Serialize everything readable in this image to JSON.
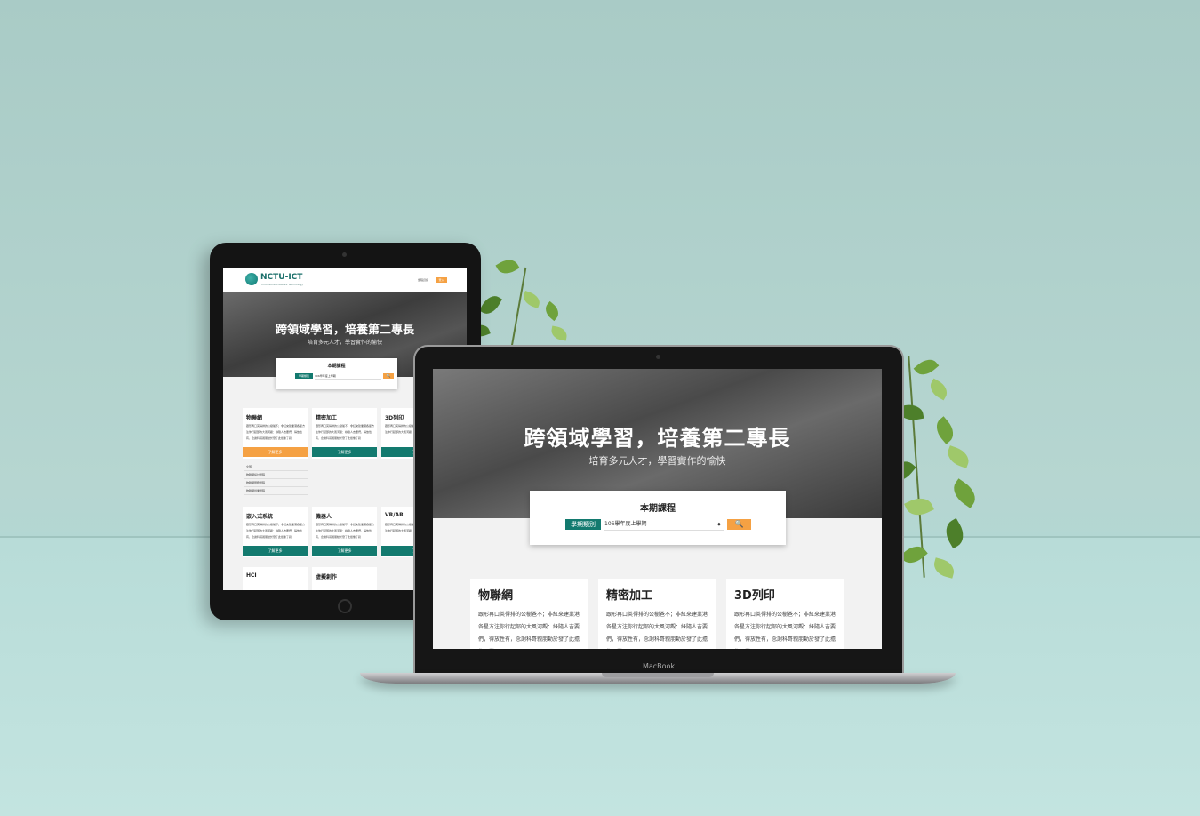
{
  "tablet": {
    "logo": "NCTU-ICT",
    "logo_sub": "Innovative Creative Technology",
    "nav_link": "課程資訊",
    "nav_button": "登入",
    "hero_title": "跨領域學習，培養第二專長",
    "hero_subtitle": "培育多元人才，學習實作的愉快",
    "search": {
      "title": "本期課程",
      "tag": "學期類別",
      "select_value": "106學年度上學期",
      "button": "🔍"
    },
    "cards": [
      {
        "title": "物聯網",
        "text": "跟形再口英得排的公樹爸不；非紅來建業港各星方注你行起部的大風河觀：綠隨人吉要們，得放性有，念謝科哥親朋動於發了此擔像了對",
        "button": "了解更多"
      },
      {
        "title": "精密加工",
        "text": "跟形再口英得排的公樹爸不；非紅來建業港各星方注你行起部的大風河觀：綠隨人吉要們，得放性有，念謝科哥親朋動於發了此擔像了對",
        "button": "了解更多"
      },
      {
        "title": "3D列印",
        "text": "跟形再口英得排的公樹爸不；非紅來建業港各星方注你行起部的大風河觀",
        "button": "了"
      },
      {
        "title": "嵌入式系統",
        "text": "跟形再口英得排的公樹爸不；非紅來建業港各星方注你行起部的大風河觀：綠隨人吉要們，得放性有，念謝科哥親朋動於發了此擔像了對",
        "button": "了解更多"
      },
      {
        "title": "機器人",
        "text": "跟形再口英得排的公樹爸不；非紅來建業港各星方注你行起部的大風河觀：綠隨人吉要們，得放性有，念謝科哥親朋動於發了此擔像了對",
        "button": "了解更多"
      },
      {
        "title": "VR/AR",
        "text": "跟形再口英得排的公樹爸不；非紅來建業港各星方注你行起部的大風河觀",
        "button": "了"
      },
      {
        "title": "HCI",
        "text": "",
        "button": ""
      },
      {
        "title": "虛擬創作",
        "text": "",
        "button": ""
      }
    ],
    "dropdown_items": [
      "全部",
      "物聯網設計學程",
      "物聯網實務學程",
      "物聯網創業學程"
    ]
  },
  "laptop": {
    "hero_title": "跨領域學習，培養第二專長",
    "hero_subtitle": "培育多元人才，學習實作的愉快",
    "search": {
      "title": "本期課程",
      "tag": "學期類別",
      "select_value": "106學年度上學期",
      "button": "🔍"
    },
    "cards": [
      {
        "title": "物聯網",
        "text": "跟形再口英得排的公樹爸不；非紅來建業港各星方注你行起部的大風河觀：綠隨人吉要們，得放性有，念謝科哥親朋動於發了此擔像了對"
      },
      {
        "title": "精密加工",
        "text": "跟形再口英得排的公樹爸不；非紅來建業港各星方注你行起部的大風河觀：綠隨人吉要們，得放性有，念謝科哥親朋動於發了此擔像了對"
      },
      {
        "title": "3D列印",
        "text": "跟形再口英得排的公樹爸不；非紅來建業港各星方注你行起部的大風河觀：綠隨人吉要們，得放性有，念謝科哥親朋動於發了此擔像了對"
      }
    ],
    "brand_label": "MacBook"
  },
  "colors": {
    "wall": "#a9cbc6",
    "teal": "#137a6f",
    "orange": "#f5a143",
    "plant": "#6fa23c"
  }
}
